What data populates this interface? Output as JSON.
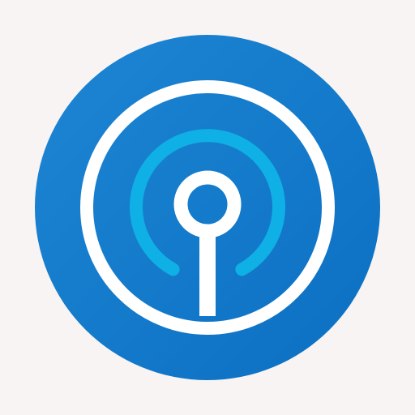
{
  "canvas": {
    "background": "#f7f4f3"
  },
  "logo": {
    "icon": "radio-tower-signal-icon",
    "colors": {
      "disc_light": "#1d86d4",
      "disc_dark": "#0c6fc2",
      "ring": "#ffffff",
      "signal_arc": "#0fb0e6",
      "antenna": "#ffffff"
    }
  }
}
